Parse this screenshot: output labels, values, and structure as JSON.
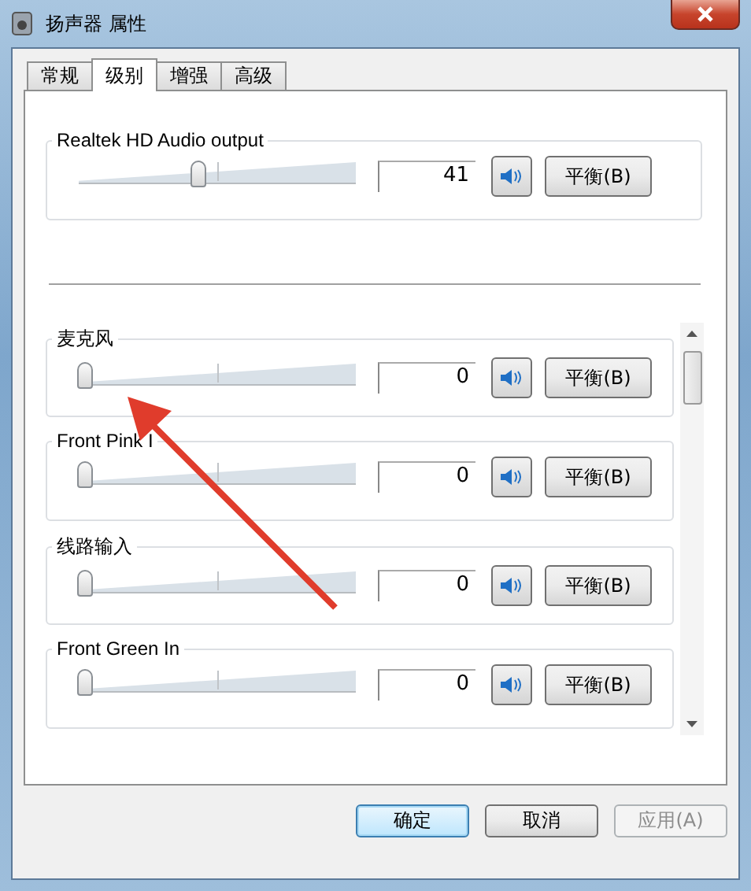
{
  "window": {
    "title": "扬声器 属性"
  },
  "tabs": [
    {
      "label": "常规",
      "selected": false
    },
    {
      "label": "级别",
      "selected": true
    },
    {
      "label": "增强",
      "selected": false
    },
    {
      "label": "高级",
      "selected": false
    }
  ],
  "output": {
    "name": "Realtek HD Audio output",
    "level": 0.41,
    "value": "41",
    "muted": false,
    "balance_button": "平衡(B)"
  },
  "inputs": [
    {
      "name": "麦克风",
      "level": 0,
      "value": "0",
      "muted": false,
      "balance_button": "平衡(B)"
    },
    {
      "name": "Front Pink I",
      "level": 0,
      "value": "0",
      "muted": false,
      "balance_button": "平衡(B)"
    },
    {
      "name": "线路输入",
      "level": 0,
      "value": "0",
      "muted": false,
      "balance_button": "平衡(B)"
    },
    {
      "name": "Front Green In",
      "level": 0,
      "value": "0",
      "muted": false,
      "balance_button": "平衡(B)"
    }
  ],
  "buttons": [
    {
      "label": "确定",
      "default": true,
      "disabled": false
    },
    {
      "label": "取消",
      "default": false,
      "disabled": false
    },
    {
      "label": "应用(A)",
      "default": false,
      "disabled": true
    }
  ]
}
